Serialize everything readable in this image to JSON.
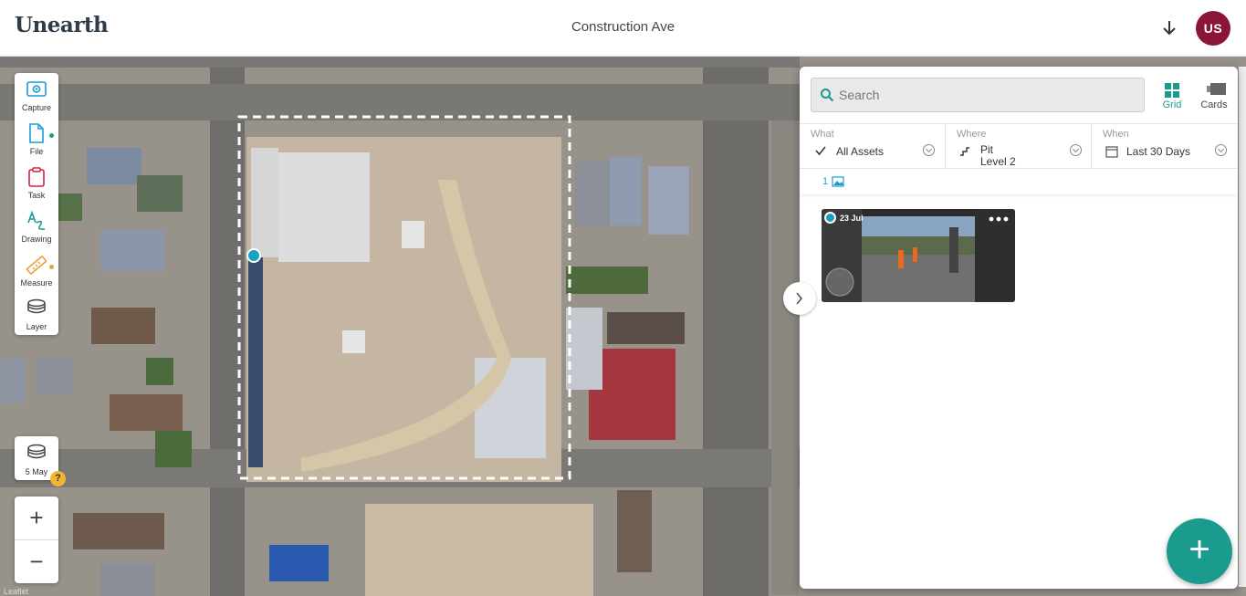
{
  "header": {
    "logo_text": "Unearth",
    "project_title": "Construction Ave",
    "download_icon": "download-arrow-icon",
    "avatar_initials": "US",
    "avatar_color": "#8b1538"
  },
  "toolbar": {
    "items": [
      {
        "label": "Capture",
        "icon": "camera-icon",
        "color": "#1a9bd7"
      },
      {
        "label": "File",
        "icon": "file-icon",
        "color": "#1a9bd7",
        "indicator_color": "#1a9b8e"
      },
      {
        "label": "Task",
        "icon": "clipboard-icon",
        "color": "#d0213b"
      },
      {
        "label": "Drawing",
        "icon": "drawing-icon",
        "color": "#1a9b8e"
      },
      {
        "label": "Measure",
        "icon": "ruler-icon",
        "color": "#e8a23c",
        "indicator_color": "#e8a23c"
      },
      {
        "label": "Layer",
        "icon": "layers-icon",
        "color": "#444"
      }
    ]
  },
  "date_layer": {
    "label": "5 May",
    "help": "?"
  },
  "zoom": {
    "in": "+",
    "out": "−"
  },
  "map": {
    "attribution": "Leaflet"
  },
  "panel": {
    "search": {
      "placeholder": "Search",
      "value": ""
    },
    "views": [
      {
        "label": "Grid",
        "icon": "grid-icon",
        "active": true
      },
      {
        "label": "Cards",
        "icon": "cards-icon",
        "active": false
      }
    ],
    "filters": {
      "what": {
        "heading": "What",
        "value": "All Assets",
        "icon": "check-icon"
      },
      "where": {
        "heading": "Where",
        "value_line1": "Pit",
        "value_line2": "Level 2",
        "icon": "stairs-icon"
      },
      "when": {
        "heading": "When",
        "value": "Last 30 Days",
        "icon": "calendar-icon"
      }
    },
    "asset_count": "1",
    "assets": [
      {
        "date": "23 Jul",
        "type": "photo-360"
      }
    ],
    "add_button": "+"
  },
  "colors": {
    "accent": "#1a9b8e",
    "link": "#1a9bd7"
  }
}
